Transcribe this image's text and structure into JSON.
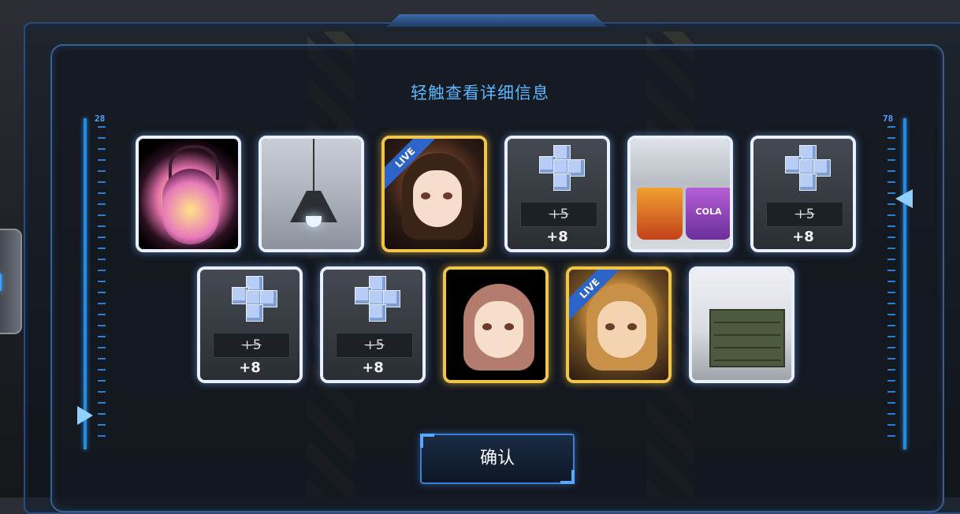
{
  "dialog": {
    "title": "轻触查看详细信息",
    "confirm_label": "确认"
  },
  "rulers": {
    "left_number": "28",
    "right_number": "78"
  },
  "rewards_row1": [
    {
      "item": "halloween-lantern",
      "frame": "white"
    },
    {
      "item": "pendant-lamp",
      "frame": "white"
    },
    {
      "item": "character-live-1",
      "frame": "gold",
      "tag": "LIVE"
    },
    {
      "item": "cube-material",
      "frame": "white",
      "old_value": "+5",
      "new_value": "+8"
    },
    {
      "item": "cola-popcorn",
      "frame": "white",
      "label": "COLA"
    },
    {
      "item": "cube-material",
      "frame": "white",
      "old_value": "+5",
      "new_value": "+8"
    }
  ],
  "rewards_row2": [
    {
      "item": "cube-material",
      "frame": "white",
      "old_value": "+5",
      "new_value": "+8"
    },
    {
      "item": "cube-material",
      "frame": "white",
      "old_value": "+5",
      "new_value": "+8"
    },
    {
      "item": "character-portrait-2",
      "frame": "gold"
    },
    {
      "item": "character-live-3",
      "frame": "gold",
      "tag": "LIVE"
    },
    {
      "item": "filing-cabinet",
      "frame": "white"
    }
  ],
  "colors": {
    "accent": "#59b6ff",
    "gold_frame": "#f0c54a",
    "white_frame": "#e9f0fb"
  }
}
